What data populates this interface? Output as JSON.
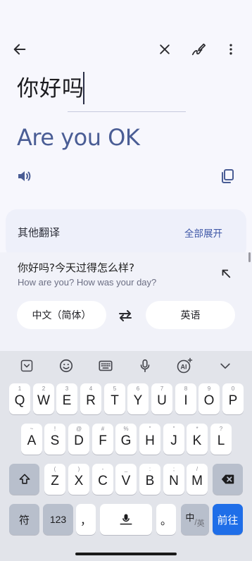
{
  "toolbar": {
    "back_icon": "back-arrow-icon",
    "clear_icon": "close-icon",
    "handwriting_icon": "handwriting-icon",
    "more_icon": "more-vertical-icon"
  },
  "source": {
    "text": "你好吗"
  },
  "translation": {
    "text": "Are you OK"
  },
  "other_translations": {
    "title": "其他翻译",
    "expand_label": "全部展开"
  },
  "suggestion": {
    "source": "你好吗?今天过得怎么样?",
    "target": "How are you? How was your day?"
  },
  "languages": {
    "source": "中文（简体）",
    "target": "英语"
  },
  "keyboard": {
    "row1": [
      {
        "main": "Q",
        "sub": "1"
      },
      {
        "main": "W",
        "sub": "2"
      },
      {
        "main": "E",
        "sub": "3"
      },
      {
        "main": "R",
        "sub": "4"
      },
      {
        "main": "T",
        "sub": "5"
      },
      {
        "main": "Y",
        "sub": "6"
      },
      {
        "main": "U",
        "sub": "7"
      },
      {
        "main": "I",
        "sub": "8"
      },
      {
        "main": "O",
        "sub": "9"
      },
      {
        "main": "P",
        "sub": "0"
      }
    ],
    "row2": [
      {
        "main": "A",
        "sub": "~"
      },
      {
        "main": "S",
        "sub": "!"
      },
      {
        "main": "D",
        "sub": "@"
      },
      {
        "main": "F",
        "sub": "#"
      },
      {
        "main": "G",
        "sub": "%"
      },
      {
        "main": "H",
        "sub": "\""
      },
      {
        "main": "J",
        "sub": "\""
      },
      {
        "main": "K",
        "sub": "*"
      },
      {
        "main": "L",
        "sub": "?"
      }
    ],
    "row3": [
      {
        "main": "Z",
        "sub": "("
      },
      {
        "main": "X",
        "sub": ")"
      },
      {
        "main": "C",
        "sub": "-"
      },
      {
        "main": "V",
        "sub": "_"
      },
      {
        "main": "B",
        "sub": ":"
      },
      {
        "main": "N",
        "sub": ";"
      },
      {
        "main": "M",
        "sub": "/"
      }
    ],
    "symbols_label": "符",
    "numbers_label": "123",
    "comma_label": "，",
    "period_label": "。",
    "lang_switch_label": "中",
    "lang_switch_sub": "英",
    "go_label": "前往"
  }
}
